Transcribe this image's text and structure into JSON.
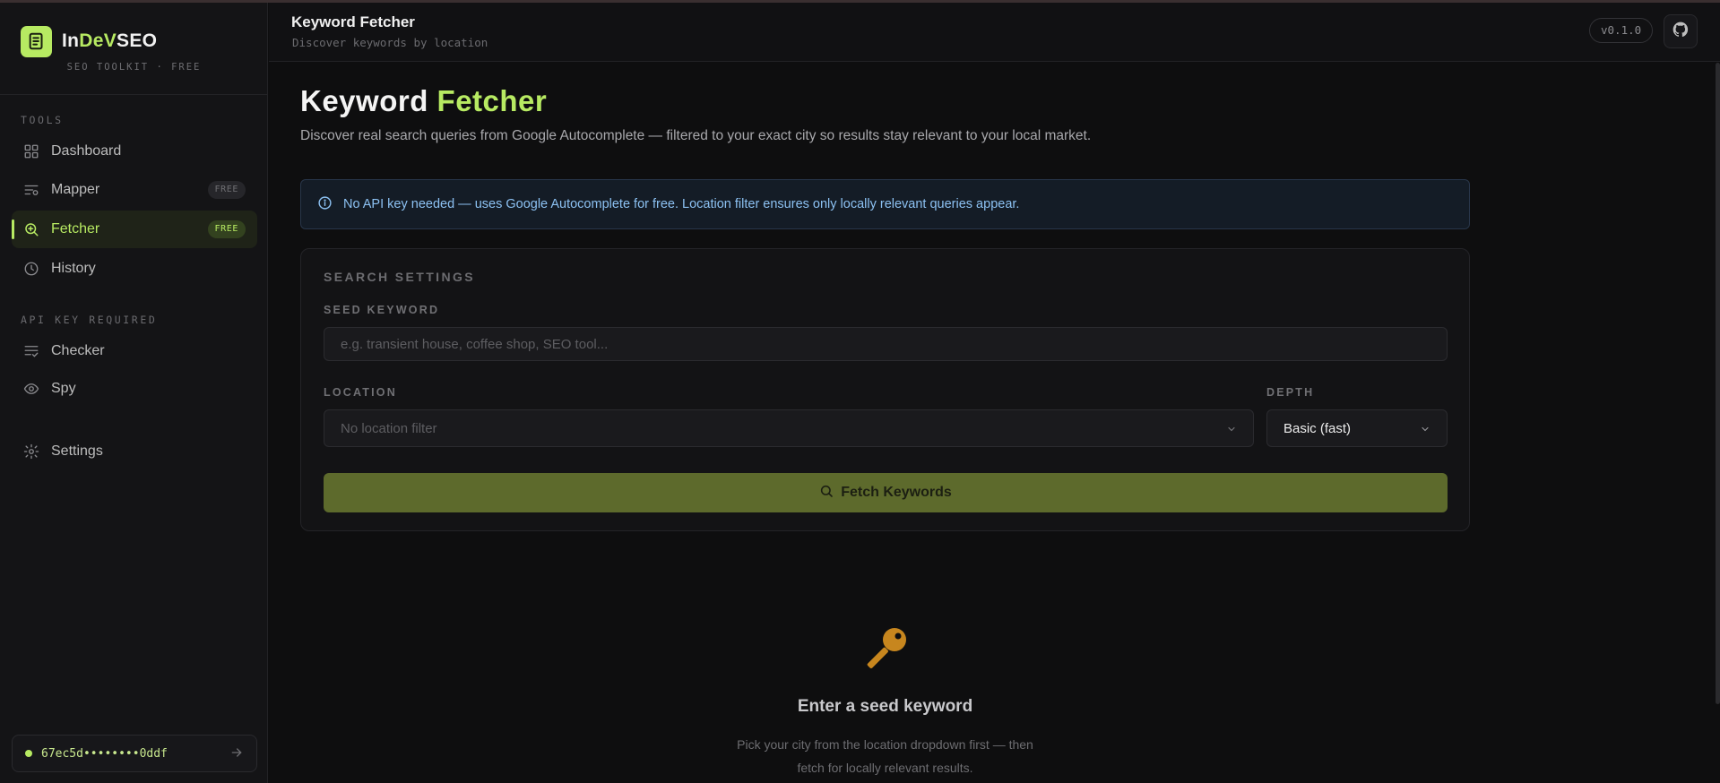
{
  "brand": {
    "name_prefix": "In",
    "name_accent": "DeV",
    "name_suffix": "SEO",
    "tagline": "SEO TOOLKIT · FREE",
    "logo_icon": "document-list-icon"
  },
  "sidebar": {
    "tools_label": "TOOLS",
    "items": [
      {
        "label": "Dashboard",
        "icon": "grid-icon",
        "badge": ""
      },
      {
        "label": "Mapper",
        "icon": "list-icon",
        "badge": "FREE"
      },
      {
        "label": "Fetcher",
        "icon": "search-plus-icon",
        "badge": "FREE",
        "active": true
      },
      {
        "label": "History",
        "icon": "clock-icon",
        "badge": ""
      }
    ],
    "api_label": "API KEY REQUIRED",
    "api_items": [
      {
        "label": "Checker",
        "icon": "list-check-icon"
      },
      {
        "label": "Spy",
        "icon": "eye-icon"
      }
    ],
    "settings_label": "Settings",
    "api_key": "67ec5d••••••••0ddf"
  },
  "header": {
    "title": "Keyword Fetcher",
    "subtitle": "Discover keywords by location",
    "version": "v0.1.0"
  },
  "main": {
    "title_part1": "Keyword",
    "title_part2": "Fetcher",
    "description": "Discover real search queries from Google Autocomplete — filtered to your exact city so results stay relevant to your local market.",
    "info": "No API key needed — uses Google Autocomplete for free. Location filter ensures only locally relevant queries appear.",
    "settings": {
      "title": "SEARCH SETTINGS",
      "seed_label": "SEED KEYWORD",
      "seed_placeholder": "e.g. transient house, coffee shop, SEO tool...",
      "location_label": "LOCATION",
      "location_value": "No location filter",
      "depth_label": "DEPTH",
      "depth_value": "Basic (fast)",
      "button": "Fetch Keywords"
    },
    "empty": {
      "title": "Enter a seed keyword",
      "line1": "Pick your city from the location dropdown first — then",
      "line2": "fetch for locally relevant results."
    }
  },
  "colors": {
    "accent": "#b7ea62",
    "button": "#5d6a2c",
    "info_text": "#8cc1f2",
    "background": "#0e0e0f"
  }
}
